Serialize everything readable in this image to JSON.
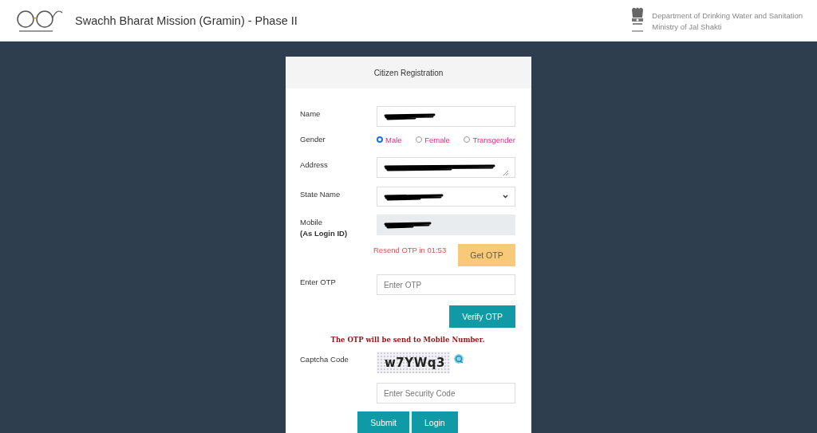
{
  "header": {
    "title": "Swachh Bharat Mission (Gramin) - Phase II",
    "department": "Department of Drinking Water and Sanitation",
    "ministry": "Ministry of Jal Shakti"
  },
  "form": {
    "title": "Citizen Registration",
    "fields": [
      {
        "kind": "text",
        "label": "Name"
      },
      {
        "kind": "radio",
        "label": "Gender",
        "options": [
          {
            "label": "Male",
            "selected": true
          },
          {
            "label": "Female",
            "selected": false
          },
          {
            "label": "Transgender",
            "selected": false
          }
        ]
      },
      {
        "kind": "textarea",
        "label": "Address"
      },
      {
        "kind": "select",
        "label": "State Name"
      },
      {
        "kind": "readonly",
        "label": "Mobile",
        "sublabel": "(As Login ID)"
      }
    ],
    "resend_timer": "Resend OTP in 01:53",
    "get_otp_button": "Get OTP",
    "otp_field": {
      "label": "Enter OTP",
      "placeholder": "Enter OTP"
    },
    "verify_button": "Verify OTP",
    "notice": "The OTP will be send to Mobile Number.",
    "captcha": {
      "label": "Captcha Code",
      "code": "w7YWq3"
    },
    "security_field": {
      "placeholder": "Enter Security Code"
    },
    "buttons": [
      "Submit",
      "Login"
    ]
  }
}
